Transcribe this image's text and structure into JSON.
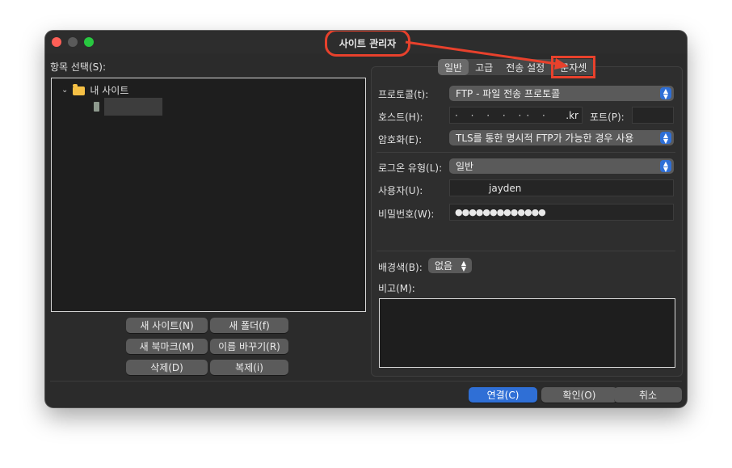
{
  "window": {
    "title": "사이트 관리자"
  },
  "colors": {
    "accent": "#2f6fd6",
    "annotation": "#e8412c"
  },
  "left": {
    "list_label": "항목 선택(S):",
    "tree": [
      {
        "label": "내 사이트",
        "icon": "folder-icon"
      },
      {
        "label": "",
        "icon": "server-icon"
      }
    ],
    "buttons": {
      "new_site": "새 사이트(N)",
      "new_folder": "새 폴더(f)",
      "new_bookmark": "새 북마크(M)",
      "rename": "이름 바꾸기(R)",
      "delete": "삭제(D)",
      "duplicate": "복제(i)"
    }
  },
  "tabs": [
    {
      "label": "일반",
      "active": true
    },
    {
      "label": "고급"
    },
    {
      "label": "전송 설정"
    },
    {
      "label": "문자셋",
      "highlighted": true
    }
  ],
  "form": {
    "protocol": {
      "label": "프로토콜(t):",
      "value": "FTP - 파일 전송 프로토콜"
    },
    "host": {
      "label": "호스트(H):",
      "value": ".kr",
      "masked": "· · ·  · ·· ·"
    },
    "port": {
      "label": "포트(P):",
      "value": ""
    },
    "encryption": {
      "label": "암호화(E):",
      "value": "TLS를 통한 명시적 FTP가 가능한 경우 사용"
    },
    "logon_type": {
      "label": "로그온 유형(L):",
      "value": "일반"
    },
    "user": {
      "label": "사용자(U):",
      "value": "jayden"
    },
    "password": {
      "label": "비밀번호(W):",
      "value": "●●●●●●●●●●●●●"
    },
    "bgcolor": {
      "label": "배경색(B):",
      "value": "없음"
    },
    "memo": {
      "label": "비고(M):",
      "value": ""
    }
  },
  "footer": {
    "connect": "연결(C)",
    "ok": "확인(O)",
    "cancel": "취소"
  }
}
